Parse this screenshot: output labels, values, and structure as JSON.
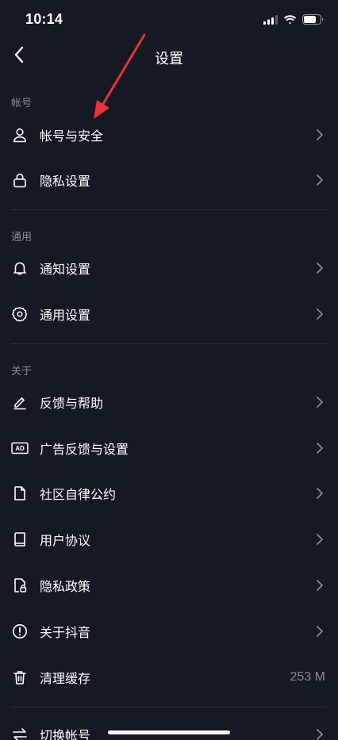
{
  "status_bar": {
    "time": "10:14",
    "battery_icon": "battery-icon",
    "wifi_icon": "wifi-icon",
    "signal_icon": "signal-icon"
  },
  "nav": {
    "title": "设置",
    "back_icon": "back-chevron-icon"
  },
  "sections": [
    {
      "header": "帐号",
      "items": [
        {
          "id": "account-security",
          "label": "帐号与安全",
          "icon": "user-icon"
        },
        {
          "id": "privacy-settings",
          "label": "隐私设置",
          "icon": "lock-icon"
        }
      ]
    },
    {
      "header": "通用",
      "items": [
        {
          "id": "notification-settings",
          "label": "通知设置",
          "icon": "bell-icon"
        },
        {
          "id": "general-settings",
          "label": "通用设置",
          "icon": "gear-icon"
        }
      ]
    },
    {
      "header": "关于",
      "items": [
        {
          "id": "feedback-help",
          "label": "反馈与帮助",
          "icon": "pencil-icon"
        },
        {
          "id": "ad-feedback",
          "label": "广告反馈与设置",
          "icon": "ad-icon"
        },
        {
          "id": "community-guidelines",
          "label": "社区自律公约",
          "icon": "document-icon"
        },
        {
          "id": "user-agreement",
          "label": "用户协议",
          "icon": "book-icon"
        },
        {
          "id": "privacy-policy",
          "label": "隐私政策",
          "icon": "document-lock-icon"
        },
        {
          "id": "about-douyin",
          "label": "关于抖音",
          "icon": "info-icon"
        },
        {
          "id": "clear-cache",
          "label": "清理缓存",
          "icon": "trash-icon",
          "value": "253 M"
        }
      ]
    },
    {
      "header": "",
      "items": [
        {
          "id": "switch-account",
          "label": "切换帐号",
          "icon": "switch-icon"
        }
      ]
    }
  ],
  "colors": {
    "background": "#161823",
    "text": "#ffffff",
    "muted": "#8a8b91",
    "divider": "#2b2d38",
    "annotation": "#e8333a"
  }
}
